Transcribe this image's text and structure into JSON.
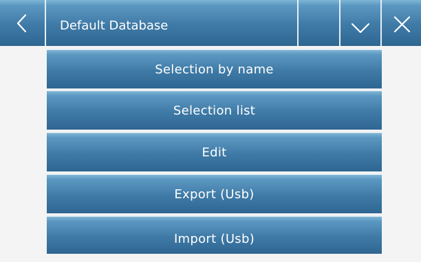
{
  "header": {
    "back_icon": "chevron-left-icon",
    "title": "Default Database",
    "down_icon": "chevron-down-icon",
    "close_icon": "close-icon"
  },
  "menu": {
    "items": [
      {
        "label": "Selection by name"
      },
      {
        "label": "Selection list"
      },
      {
        "label": "Edit"
      },
      {
        "label": "Export (Usb)"
      },
      {
        "label": "Import (Usb)"
      }
    ]
  },
  "colors": {
    "button_gradient_top": "#7fb6d6",
    "button_gradient_bottom": "#2f6692",
    "background": "#f4f4f4",
    "text": "#ffffff"
  }
}
